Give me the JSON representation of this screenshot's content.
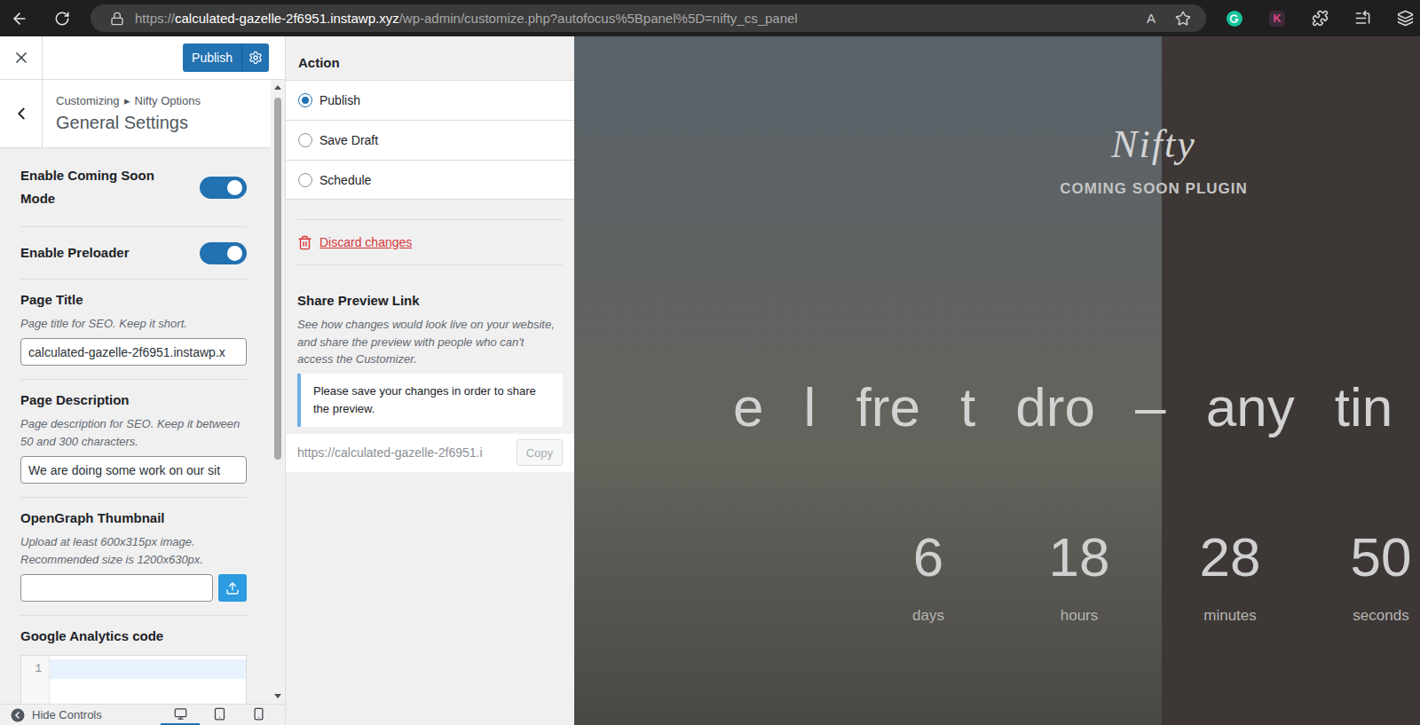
{
  "browser": {
    "url_scheme": "https://",
    "url_host": "calculated-gazelle-2f6951.instawp.xyz",
    "url_path": "/wp-admin/customize.php?autofocus%5Bpanel%5D=nifty_cs_panel",
    "read_aloud": "A",
    "extension_badge": "K"
  },
  "customizer": {
    "publish_button": "Publish",
    "breadcrumb": [
      "Customizing",
      "▸",
      "Nifty Options"
    ],
    "panel_title": "General Settings",
    "settings": [
      {
        "kind": "toggle",
        "label": "Enable Coming Soon Mode",
        "on": true
      },
      {
        "kind": "toggle",
        "label": "Enable Preloader",
        "on": true
      },
      {
        "kind": "text",
        "label": "Page Title",
        "description": "Page title for SEO. Keep it short.",
        "value": "calculated-gazelle-2f6951.instawp.x"
      },
      {
        "kind": "text",
        "label": "Page Description",
        "description": "Page description for SEO. Keep it between 50 and 300 characters.",
        "value": "We are doing some work on our sit"
      },
      {
        "kind": "upload",
        "label": "OpenGraph Thumbnail",
        "description": "Upload at least 600x315px image. Recommended size is 1200x630px.",
        "value": ""
      },
      {
        "kind": "code",
        "label": "Google Analytics code",
        "line_numbers": [
          "1"
        ]
      }
    ],
    "footer": {
      "hide_controls": "Hide Controls",
      "devices": [
        {
          "kind": "desktop",
          "selected": true
        },
        {
          "kind": "tablet",
          "selected": false
        },
        {
          "kind": "mobile",
          "selected": false
        }
      ]
    }
  },
  "publish_settings": {
    "heading": "Action",
    "actions": [
      {
        "label": "Publish",
        "selected": true
      },
      {
        "label": "Save Draft",
        "selected": false
      },
      {
        "label": "Schedule",
        "selected": false
      }
    ],
    "discard": "Discard changes",
    "share": {
      "title": "Share Preview Link",
      "description": "See how changes would look live on your website, and share the preview with people who can't access the Customizer.",
      "notice": "Please save your changes in order to share the preview.",
      "url": "https://calculated-gazelle-2f6951.i",
      "copy_button": "Copy",
      "copy_disabled": true
    }
  },
  "preview": {
    "logo": "Nifty",
    "tagline": "COMING SOON PLUGIN",
    "headline": "e l fre t dro – any tin",
    "countdown": [
      {
        "value": "6",
        "unit": "days"
      },
      {
        "value": "18",
        "unit": "hours"
      },
      {
        "value": "28",
        "unit": "minutes"
      },
      {
        "value": "50",
        "unit": "seconds"
      }
    ]
  }
}
